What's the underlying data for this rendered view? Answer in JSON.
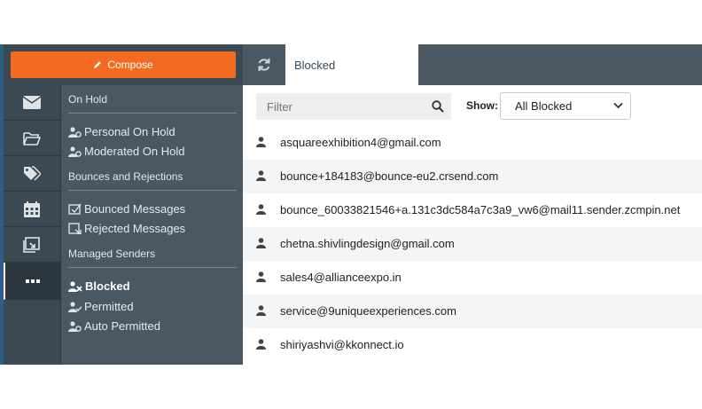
{
  "compose": {
    "label": "Compose",
    "color": "#f26b21"
  },
  "rail": [
    {
      "name": "mail",
      "icon": "envelope-icon"
    },
    {
      "name": "folders",
      "icon": "folder-open-icon"
    },
    {
      "name": "tags",
      "icon": "tags-icon"
    },
    {
      "name": "calendar",
      "icon": "calendar-icon"
    },
    {
      "name": "tasks",
      "icon": "task-icon"
    },
    {
      "name": "more",
      "icon": "ellipsis-icon",
      "active": true
    }
  ],
  "submenu": {
    "on_hold_title": "On Hold",
    "personal_on_hold": "Personal On Hold",
    "moderated_on_hold": "Moderated On Hold",
    "bounces_title": "Bounces and Rejections",
    "bounced_messages": "Bounced Messages",
    "rejected_messages": "Rejected Messages",
    "managed_title": "Managed Senders",
    "blocked": "Blocked",
    "permitted": "Permitted",
    "auto_permitted": "Auto Permitted"
  },
  "main": {
    "tab_label": "Blocked",
    "filter_placeholder": "Filter",
    "show_label": "Show:",
    "show_selected": "All Blocked"
  },
  "senders": [
    "asquareexhibition4@gmail.com",
    "bounce+184183@bounce-eu2.crsend.com",
    "bounce_60033821546+a.131c3dc584a7c3a9_vw6@mail11.sender.zcmpin.net",
    "chetna.shivlingdesign@gmail.com",
    "sales4@allianceexpo.in",
    "service@9uniqueexperiences.com",
    "shiriyashvi@kkonnect.io"
  ]
}
